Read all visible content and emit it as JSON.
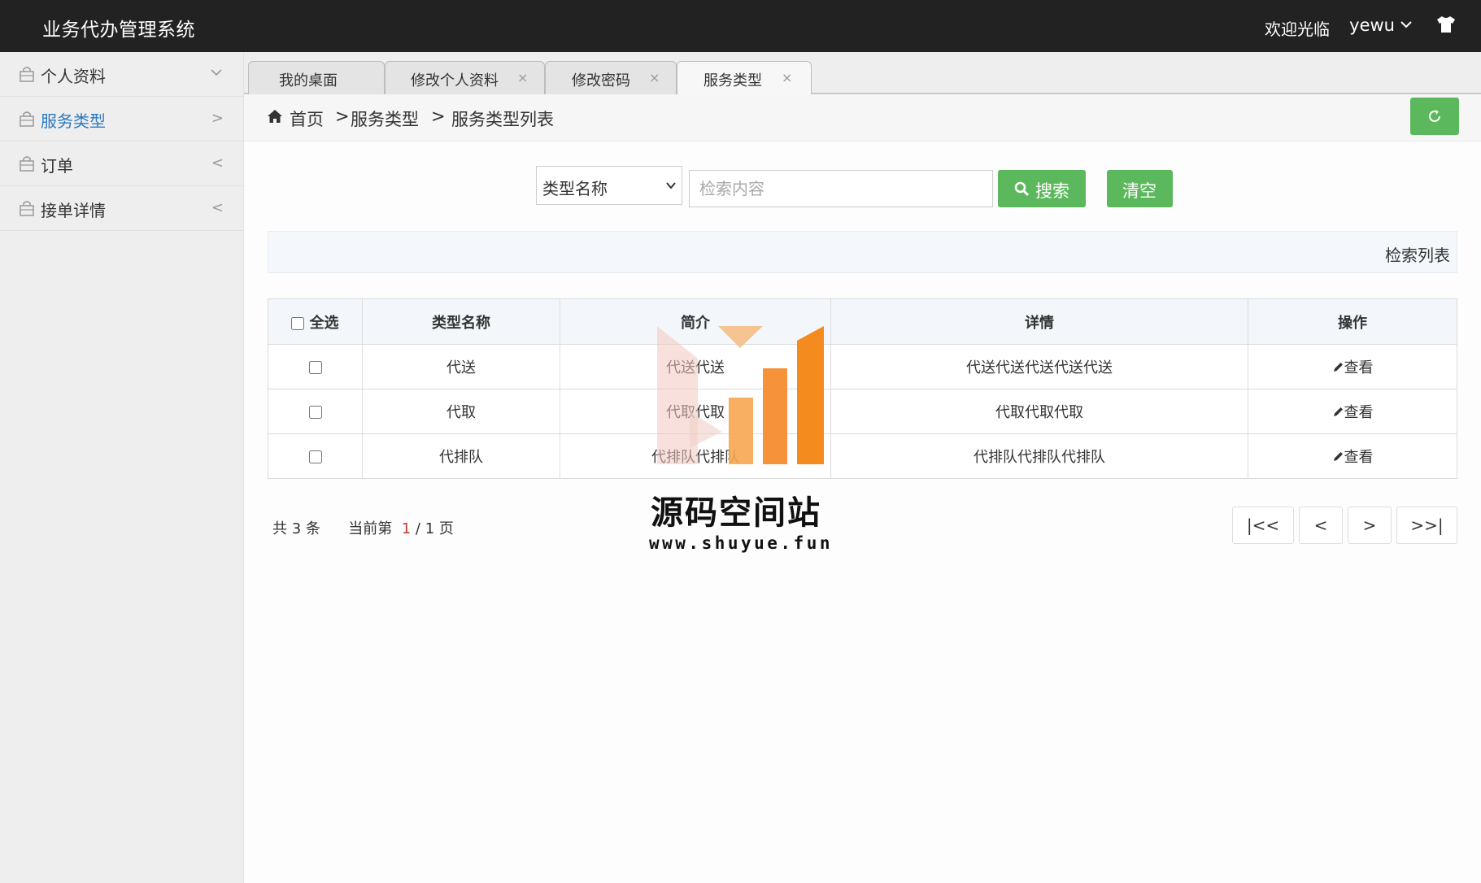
{
  "header": {
    "title": "业务代办管理系统",
    "welcome": "欢迎光临",
    "username": "yewu"
  },
  "sidebar": {
    "items": [
      {
        "label": "个人资料",
        "arrow": "v"
      },
      {
        "label": "服务类型",
        "arrow": ">"
      },
      {
        "label": "订单",
        "arrow": "<"
      },
      {
        "label": "接单详情",
        "arrow": "<"
      }
    ],
    "active_index": 1
  },
  "tabs": [
    {
      "label": "我的桌面",
      "closable": false
    },
    {
      "label": "修改个人资料",
      "closable": true
    },
    {
      "label": "修改密码",
      "closable": true
    },
    {
      "label": "服务类型",
      "closable": true,
      "active": true
    }
  ],
  "breadcrumb": {
    "home": "首页",
    "sep1": ">",
    "level1": "服务类型",
    "sep2": ">",
    "level2": "服务类型列表"
  },
  "search": {
    "select_value": "类型名称",
    "placeholder": "检索内容",
    "search_label": "搜索",
    "clear_label": "清空"
  },
  "list_title": "检索列表",
  "table": {
    "headers": {
      "select_all": "全选",
      "name": "类型名称",
      "intro": "简介",
      "detail": "详情",
      "action": "操作"
    },
    "rows": [
      {
        "name": "代送",
        "intro": "代送代送",
        "detail": "代送代送代送代送代送",
        "action": "查看"
      },
      {
        "name": "代取",
        "intro": "代取代取",
        "detail": "代取代取代取",
        "action": "查看"
      },
      {
        "name": "代排队",
        "intro": "代排队代排队",
        "detail": "代排队代排队代排队",
        "action": "查看"
      }
    ]
  },
  "pagination": {
    "total_prefix": "共",
    "total": "3",
    "total_suffix": "条",
    "current_prefix": "当前第",
    "current": "1",
    "pages": "/ 1 页",
    "first": "|<<",
    "prev": "<",
    "next": ">",
    "last": ">>|"
  },
  "watermark": {
    "name": "源码空间站",
    "url": "www.shuyue.fun"
  },
  "colors": {
    "header_bg": "#222222",
    "sidebar_bg": "#eeeeee",
    "active_link": "#2b7ac1",
    "primary_button": "#5cb85c",
    "current_page": "#c0392b",
    "logo_orange": "#f38b1f"
  }
}
